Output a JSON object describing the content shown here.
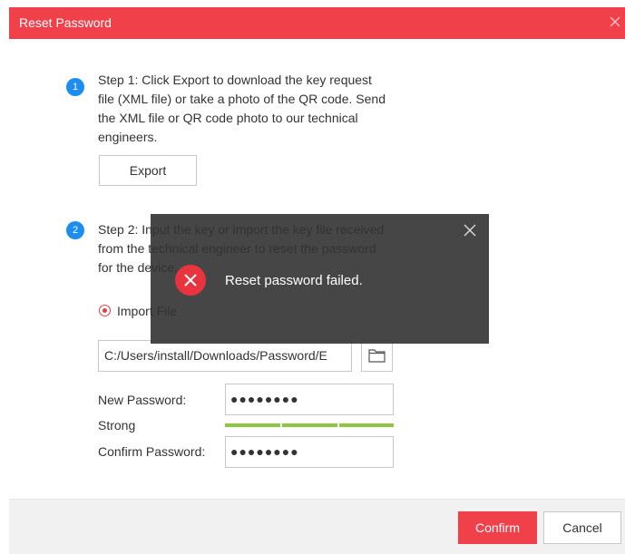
{
  "dialog": {
    "title": "Reset Password"
  },
  "step1": {
    "number": "1",
    "lines": [
      "Step 1: Click Export to download the key request",
      "file (XML file) or take a photo of the QR code. Send",
      "the XML file or QR code photo to our technical",
      "engineers."
    ],
    "export_label": "Export"
  },
  "step2": {
    "number": "2",
    "lines": [
      "Step 2: Input the key or import the key file received",
      "from the technical engineer to reset the password",
      "for the device."
    ],
    "import_option": "Import File",
    "file_path": "C:/Users/install/Downloads/Password/E"
  },
  "form": {
    "new_password_label": "New Password:",
    "new_password_value": "●●●●●●●●",
    "strength_label": "Strong",
    "confirm_password_label": "Confirm Password:",
    "confirm_password_value": "●●●●●●●●"
  },
  "footer": {
    "confirm_label": "Confirm",
    "cancel_label": "Cancel"
  },
  "toast": {
    "message": "Reset password failed."
  },
  "colors": {
    "accent": "#f0404a",
    "step_badge": "#1d8ef0",
    "strength_bar": "#8dc63f",
    "toast_bg": "#323232"
  },
  "icons": {
    "title_close": "close-icon",
    "folder": "folder-icon",
    "error": "error-x-icon",
    "toast_close": "close-icon"
  }
}
